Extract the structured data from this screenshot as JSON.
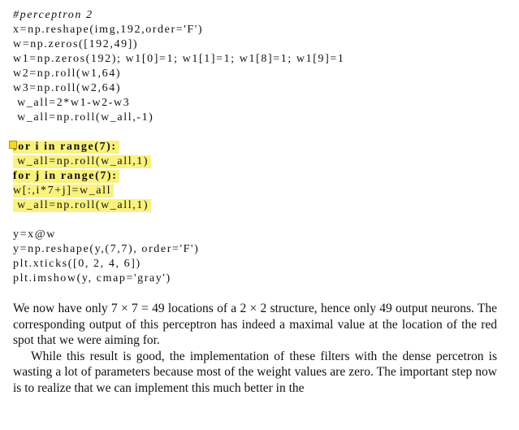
{
  "code_lines": [
    {
      "text": "#perceptron 2",
      "style": "comment"
    },
    {
      "text": "x=np.reshape(img,192,order='F')"
    },
    {
      "text": "w=np.zeros([192,49])"
    },
    {
      "text": "w1=np.zeros(192); w1[0]=1; w1[1]=1; w1[8]=1; w1[9]=1"
    },
    {
      "text": "w2=np.roll(w1,64)"
    },
    {
      "text": "w3=np.roll(w2,64)"
    },
    {
      "text": " w_all=2*w1-w2-w3"
    },
    {
      "text": " w_all=np.roll(w_all,-1)"
    },
    {
      "text": "",
      "style": "gap"
    },
    {
      "text": "for i in range(7):",
      "style": "bold",
      "highlight": true,
      "note": true
    },
    {
      "text": " w_all=np.roll(w_all,1)",
      "highlight": true
    },
    {
      "text": "for j in range(7):",
      "style": "bold",
      "highlight": true
    },
    {
      "text": "w[:,i*7+j]=w_all",
      "highlight": true
    },
    {
      "text": " w_all=np.roll(w_all,1)",
      "highlight": true
    },
    {
      "text": "",
      "style": "gap"
    },
    {
      "text": "y=x@w"
    },
    {
      "text": "y=np.reshape(y,(7,7), order='F')"
    },
    {
      "text": "plt.xticks([0, 2, 4, 6])"
    },
    {
      "text": "plt.imshow(y, cmap='gray')"
    }
  ],
  "paragraphs": [
    {
      "text": "We now have only 7 × 7 = 49 locations of a 2 × 2 structure, hence only 49 output neurons. The corresponding output of this perceptron has indeed a maximal value at the location of the red spot that we were aiming for.",
      "indent": false
    },
    {
      "text": "While this result is good, the implementation of these filters with the dense percetron is wasting a lot of parameters because most of the weight values are zero. The important step now is to realize that we can implement this much better in the",
      "indent": true
    }
  ],
  "highlight_color": "#fbf27d",
  "note_icon": "sticky-note-icon"
}
